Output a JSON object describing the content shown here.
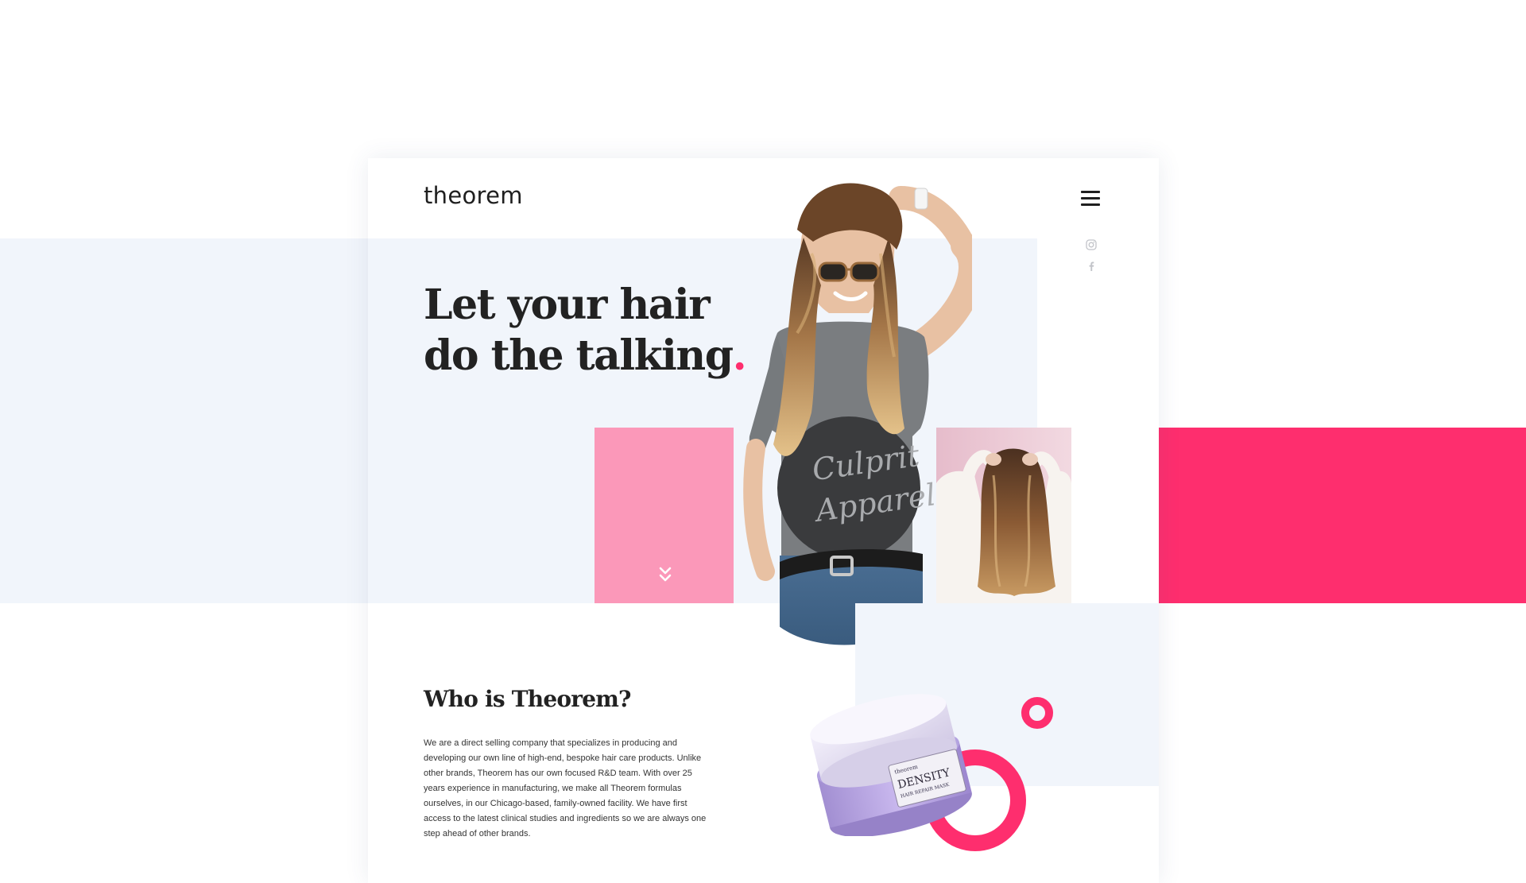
{
  "brand": {
    "logo": "theorem"
  },
  "colors": {
    "accent": "#fe2e6e",
    "light_pink": "#fb98b9",
    "pale_blue": "#f1f5fb",
    "dark_text": "#222222"
  },
  "nav": {
    "menu_icon": "hamburger-menu-icon"
  },
  "social": {
    "items": [
      {
        "icon": "instagram-icon"
      },
      {
        "icon": "facebook-icon"
      }
    ]
  },
  "hero": {
    "headline_line1": "Let your hair",
    "headline_line2": "do the talking",
    "headline_dot": ".",
    "scroll_icon": "double-chevron-down-icon",
    "shirt_text_1": "Culprit",
    "shirt_text_2": "Apparel"
  },
  "about": {
    "title": "Who is Theorem?",
    "body": "We are a direct selling company that specializes in producing and developing our own line of high-end, bespoke hair care products. Unlike other brands, Theorem has our own focused R&D team. With over 25 years experience in manufacturing, we make all Theorem formulas ourselves, in our Chicago-based, family-owned facility. We have first access to the latest clinical studies and ingredients so we are always one step ahead of other brands."
  },
  "product": {
    "brand": "theorem",
    "name": "DENSITY",
    "subtitle": "HAIR REPAIR MASK"
  }
}
